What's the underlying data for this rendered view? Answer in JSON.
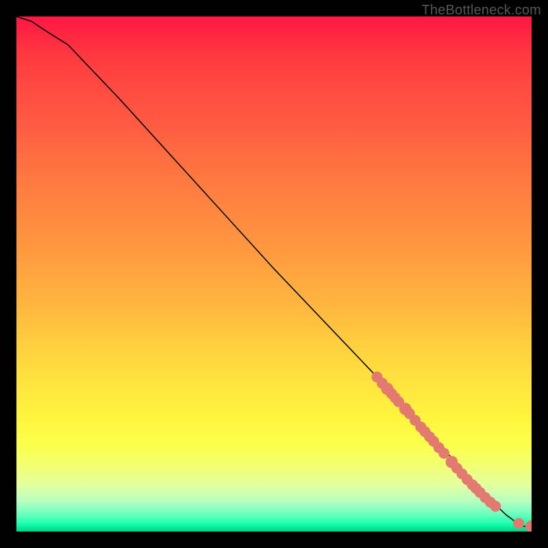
{
  "watermark": {
    "text": "TheBottleneck.com"
  },
  "colors": {
    "frame_bg": "#000000",
    "curve": "#000000",
    "dot": "#e27a70",
    "gradient_top": "#ff1744",
    "gradient_mid": "#ffe83e",
    "gradient_bottom": "#00d085"
  },
  "chart_data": {
    "type": "line",
    "title": "",
    "xlabel": "",
    "ylabel": "",
    "xlim": [
      0,
      100
    ],
    "ylim": [
      0,
      100
    ],
    "series": [
      {
        "name": "bottleneck-curve",
        "x": [
          0,
          3,
          6,
          10,
          20,
          30,
          40,
          50,
          60,
          70,
          80,
          86,
          90,
          93,
          95,
          97,
          98.5,
          100
        ],
        "y": [
          100,
          99,
          97,
          94.5,
          84,
          73,
          62,
          51,
          40.5,
          30,
          19.5,
          12.5,
          8.2,
          5.2,
          3.3,
          1.8,
          1.0,
          1.0
        ]
      }
    ],
    "highlight_points": {
      "name": "selected-components",
      "x": [
        70,
        71,
        72,
        72.8,
        73.5,
        74.2,
        75.5,
        76.3,
        77.4,
        78.5,
        79.3,
        80.2,
        81,
        82,
        83,
        84.5,
        85.5,
        86.5,
        87.5,
        88.5,
        89.2,
        90,
        91,
        92,
        93,
        97.5,
        100
      ],
      "y": [
        30,
        28.8,
        27.7,
        26.8,
        26,
        25.2,
        23.8,
        22.9,
        21.6,
        20.3,
        19.4,
        18.4,
        17.5,
        16.3,
        15.2,
        13.5,
        12.3,
        11.2,
        10.1,
        9.1,
        8.4,
        7.6,
        6.6,
        5.7,
        4.9,
        1.6,
        1.0
      ],
      "r": [
        8,
        8,
        9,
        8,
        8,
        8,
        9,
        8,
        8,
        8,
        8,
        8,
        8,
        8,
        8,
        9,
        8,
        8,
        8,
        8,
        8,
        8,
        8,
        8,
        8,
        8,
        9
      ]
    }
  }
}
